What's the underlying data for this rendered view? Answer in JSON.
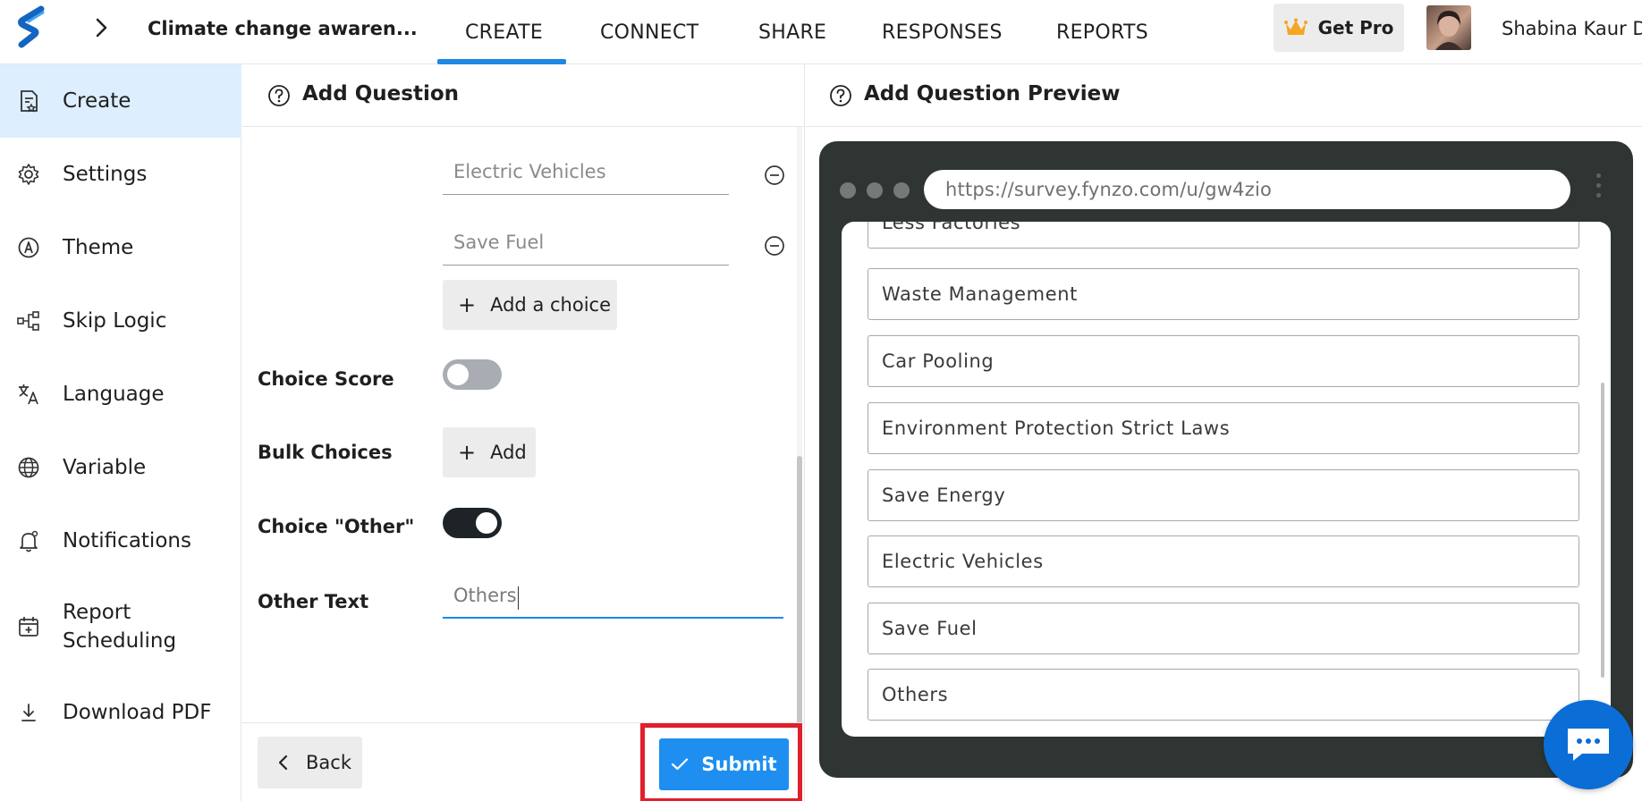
{
  "topbar": {
    "survey_title": "Climate change awaren...",
    "tabs": [
      {
        "label": "CREATE"
      },
      {
        "label": "CONNECT"
      },
      {
        "label": "SHARE"
      },
      {
        "label": "RESPONSES"
      },
      {
        "label": "REPORTS"
      }
    ],
    "active_tab": "CREATE",
    "get_pro_label": "Get Pro",
    "user_name": "Shabina Kaur D"
  },
  "sidebar": {
    "items": [
      {
        "label": "Create",
        "icon": "create-form-icon"
      },
      {
        "label": "Settings",
        "icon": "gear-icon"
      },
      {
        "label": "Theme",
        "icon": "theme-icon"
      },
      {
        "label": "Skip Logic",
        "icon": "skip-logic-icon"
      },
      {
        "label": "Language",
        "icon": "translate-icon"
      },
      {
        "label": "Variable",
        "icon": "globe-icon"
      },
      {
        "label": "Notifications",
        "icon": "bell-icon"
      },
      {
        "label": "Report\nScheduling",
        "icon": "calendar-icon"
      },
      {
        "label": "Download PDF",
        "icon": "download-icon"
      }
    ],
    "active_item": "Create"
  },
  "editor": {
    "title": "Add Question",
    "choices": [
      {
        "value": "Electric Vehicles"
      },
      {
        "value": "Save Fuel"
      }
    ],
    "add_choice_label": "Add a choice",
    "choice_score_label": "Choice Score",
    "choice_score_enabled": false,
    "bulk_choices_label": "Bulk Choices",
    "bulk_add_label": "Add",
    "choice_other_label": "Choice \"Other\"",
    "choice_other_enabled": true,
    "other_text_label": "Other Text",
    "other_text_value": "Others",
    "back_label": "Back",
    "submit_label": "Submit"
  },
  "preview": {
    "title": "Add Question Preview",
    "url": "https://survey.fynzo.com/u/gw4zio",
    "options": [
      {
        "label": "Less Factories"
      },
      {
        "label": "Waste Management"
      },
      {
        "label": "Car Pooling"
      },
      {
        "label": "Environment Protection Strict Laws"
      },
      {
        "label": "Save Energy"
      },
      {
        "label": "Electric Vehicles"
      },
      {
        "label": "Save Fuel"
      },
      {
        "label": "Others"
      }
    ]
  },
  "colors": {
    "accent": "#1e88e5",
    "submit": "#1e8ff0",
    "highlight_outline": "#e0202a",
    "sidebar_active": "#ddeeff",
    "browser_frame": "#2e3532",
    "chat_bubble": "#0b6dd6"
  }
}
